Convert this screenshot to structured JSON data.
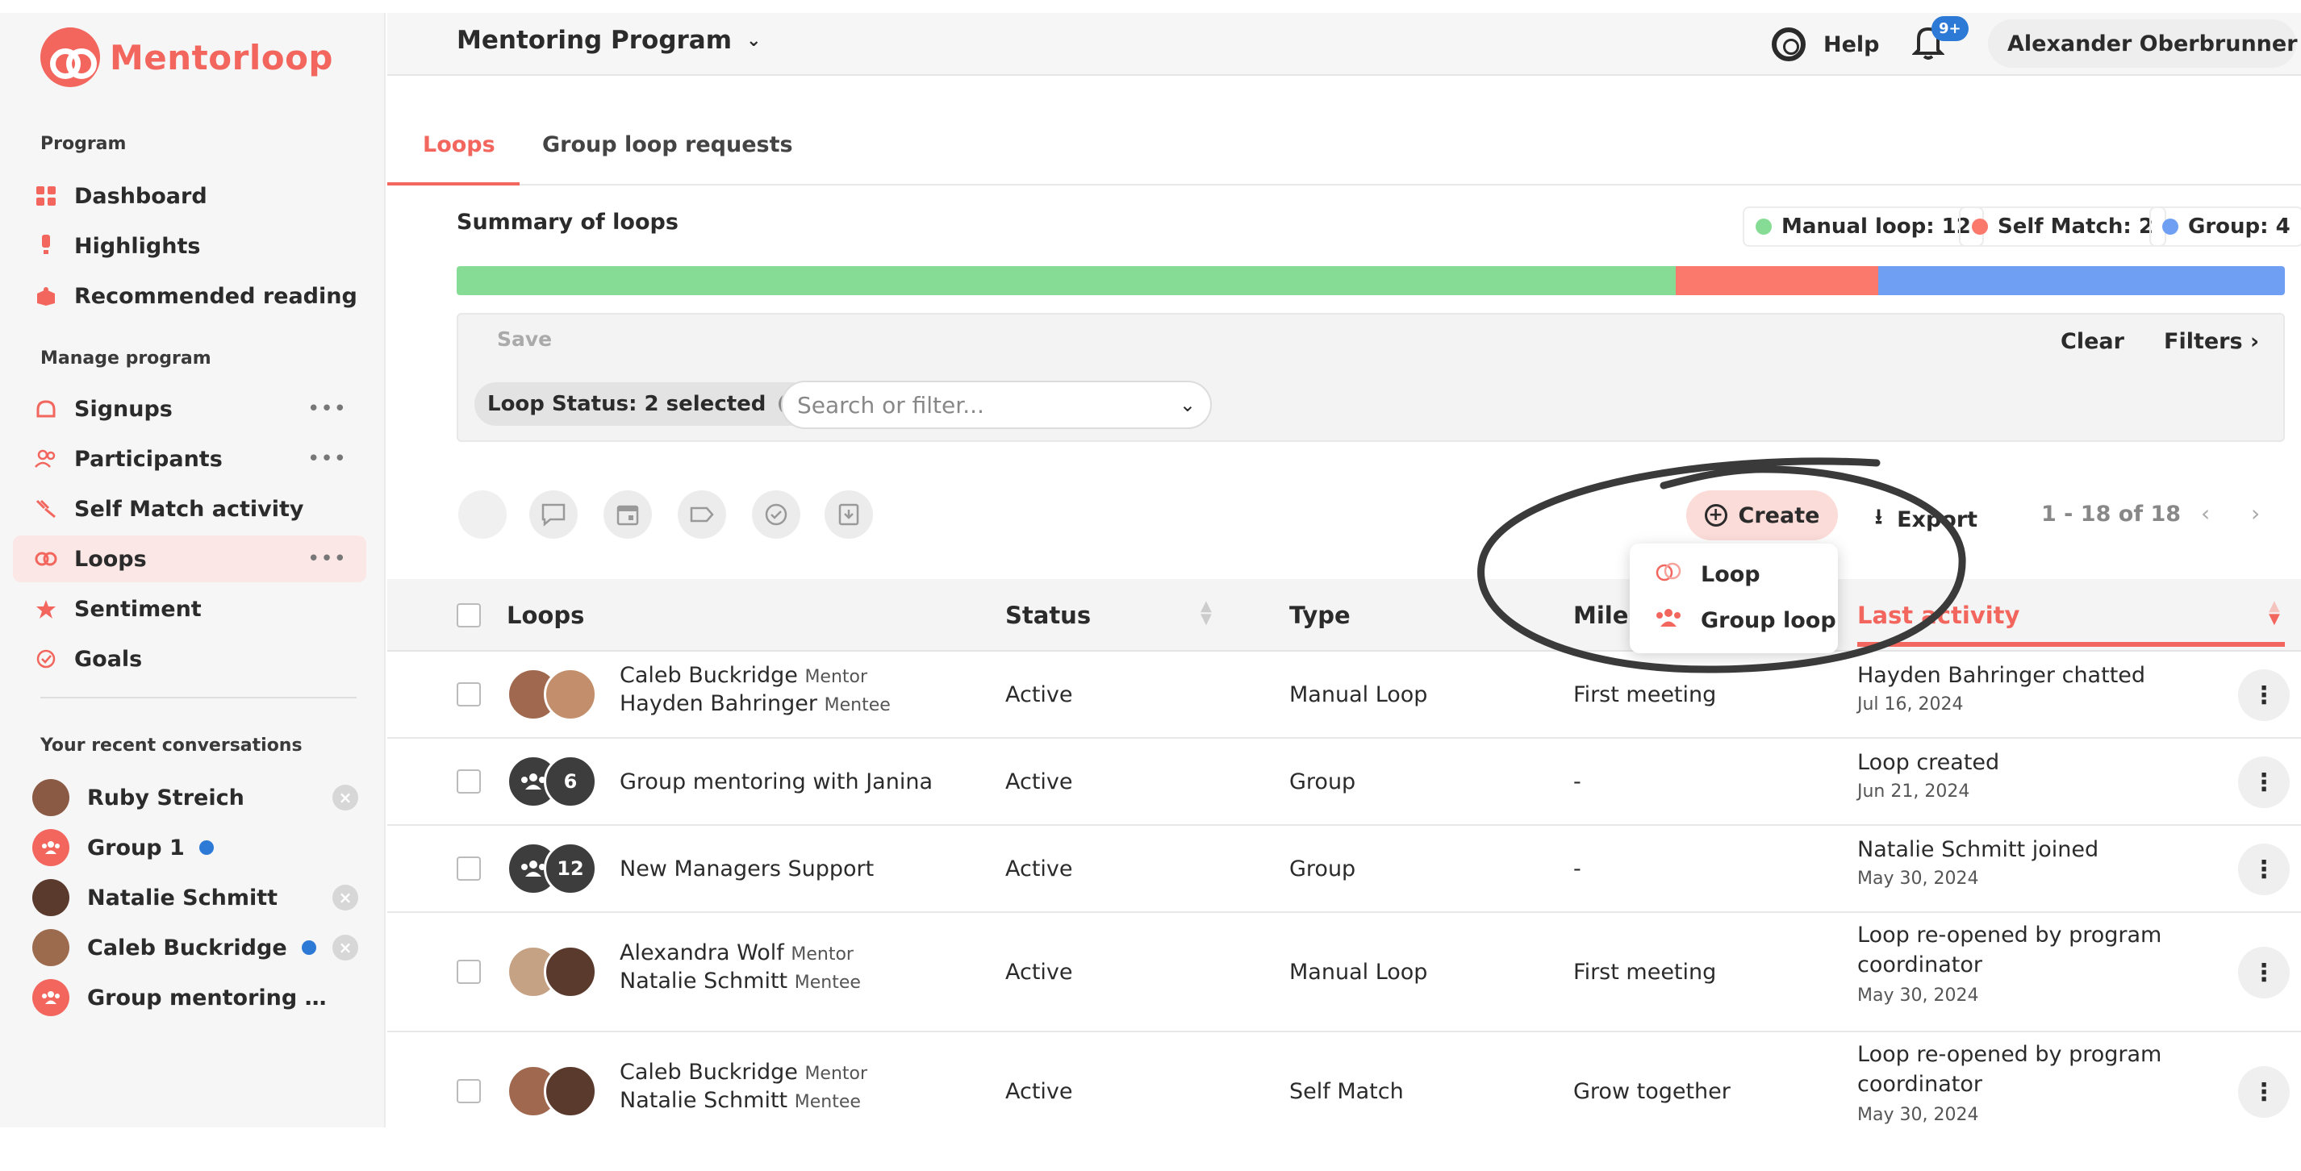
{
  "app": {
    "logo_text": "Mentorloop",
    "brand_color": "#f2665e"
  },
  "sidebar": {
    "program_label": "Program",
    "program_items": [
      {
        "label": "Dashboard",
        "icon": "grid-icon"
      },
      {
        "label": "Highlights",
        "icon": "highlight-icon"
      },
      {
        "label": "Recommended reading",
        "icon": "book-icon"
      }
    ],
    "manage_label": "Manage program",
    "manage_items": [
      {
        "label": "Signups",
        "icon": "signup-icon",
        "more": "•••"
      },
      {
        "label": "Participants",
        "icon": "participants-icon",
        "more": "•••"
      },
      {
        "label": "Self Match activity",
        "icon": "self-match-icon"
      },
      {
        "label": "Loops",
        "icon": "loop-icon",
        "more": "•••",
        "active": true
      },
      {
        "label": "Sentiment",
        "icon": "star-icon"
      },
      {
        "label": "Goals",
        "icon": "goal-icon"
      }
    ],
    "recent_label": "Your recent conversations",
    "recent": [
      {
        "name": "Ruby Streich"
      },
      {
        "name": "Group 1"
      },
      {
        "name": "Natalie Schmitt"
      },
      {
        "name": "Caleb Buckridge"
      },
      {
        "name": "Group mentoring with J..."
      }
    ]
  },
  "topbar": {
    "program": "Mentoring Program",
    "help": "Help",
    "notif_badge": "9+",
    "user_name": "Alexander Oberbrunner"
  },
  "tabs": [
    {
      "label": "Loops"
    },
    {
      "label": "Group loop requests"
    }
  ],
  "summary": {
    "title": "Summary of loops",
    "legend": [
      {
        "label": "Manual loop: 12",
        "color": "#86dc95"
      },
      {
        "label": "Self Match: 2",
        "color": "#fb786c"
      },
      {
        "label": "Group: 4",
        "color": "#6f9ff3"
      }
    ],
    "bar": [
      {
        "value": 12
      },
      {
        "value": 2
      },
      {
        "value": 4
      }
    ]
  },
  "filters": {
    "save": "Save",
    "clear": "Clear",
    "filters": "Filters",
    "status_chip": "Loop Status: 2 selected",
    "search_placeholder": "Search or filter..."
  },
  "toolbar": {
    "create": "Create",
    "export": "Export",
    "pagination": "1 - 18 of 18"
  },
  "dropdown": {
    "loop": "Loop",
    "group_loop": "Group loop"
  },
  "table": {
    "columns": {
      "loops": "Loops",
      "status": "Status",
      "type": "Type",
      "milestone": "Miles",
      "last_activity": "Last activity"
    },
    "rows": [
      {
        "line1": "Caleb Buckridge",
        "role1": "Mentor",
        "line2": "Hayden Bahringer",
        "role2": "Mentee",
        "status": "Active",
        "type": "Manual Loop",
        "milestone": "First meeting",
        "activity1": "Hayden Bahringer chatted",
        "activity2": "",
        "date": "Jul 16, 2024"
      },
      {
        "line1": "Group mentoring with Janina",
        "count": "6",
        "status": "Active",
        "type": "Group",
        "milestone": "-",
        "activity1": "Loop created",
        "activity2": "",
        "date": "Jun 21, 2024"
      },
      {
        "line1": "New Managers Support",
        "count": "12",
        "status": "Active",
        "type": "Group",
        "milestone": "-",
        "activity1": "Natalie Schmitt joined",
        "activity2": "",
        "date": "May 30, 2024"
      },
      {
        "line1": "Alexandra Wolf",
        "role1": "Mentor",
        "line2": "Natalie Schmitt",
        "role2": "Mentee",
        "status": "Active",
        "type": "Manual Loop",
        "milestone": "First meeting",
        "activity1": "Loop re-opened by program",
        "activity2": "coordinator",
        "date": "May 30, 2024"
      },
      {
        "line1": "Caleb Buckridge",
        "role1": "Mentor",
        "line2": "Natalie Schmitt",
        "role2": "Mentee",
        "status": "Active",
        "type": "Self Match",
        "milestone": "Grow together",
        "activity1": "Loop re-opened by program",
        "activity2": "coordinator",
        "date": "May 30, 2024"
      }
    ]
  }
}
